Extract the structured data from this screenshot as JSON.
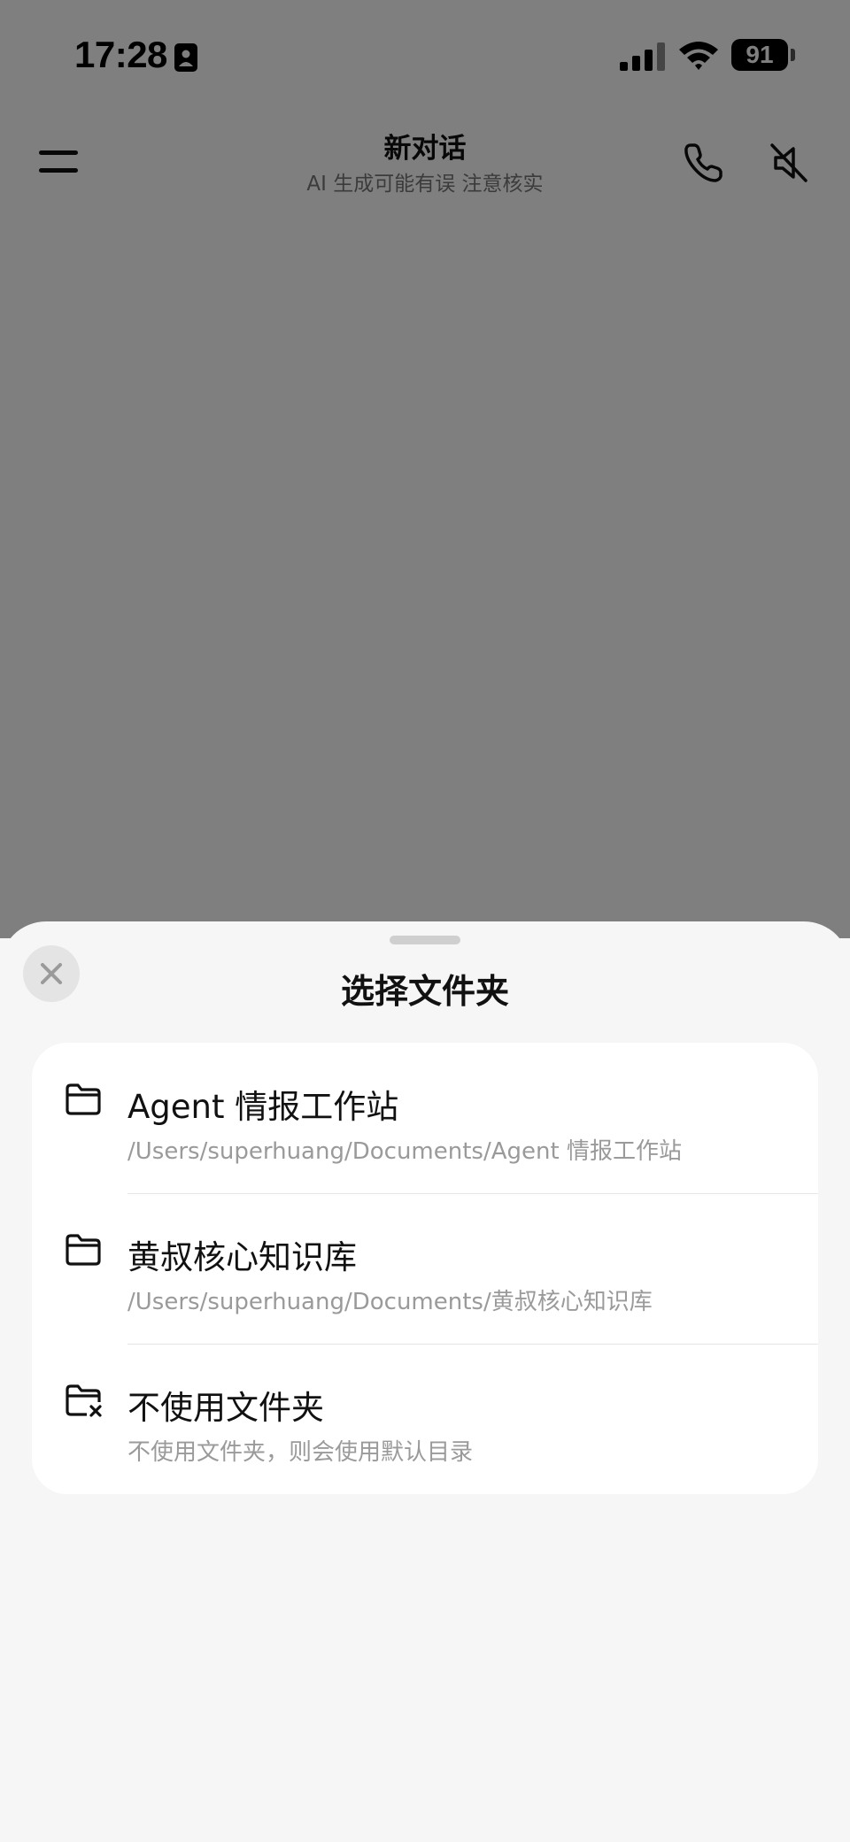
{
  "status_bar": {
    "time": "17:28",
    "battery_level": "91",
    "id_icon": "person-card-icon",
    "signal_icon": "cellular-signal-icon",
    "wifi_icon": "wifi-icon",
    "battery_icon": "battery-icon"
  },
  "header": {
    "title": "新对话",
    "subtitle": "AI 生成可能有误 注意核实",
    "menu_icon": "menu-icon",
    "call_icon": "phone-icon",
    "mute_icon": "speaker-muted-icon"
  },
  "sheet": {
    "title": "选择文件夹",
    "close_icon": "close-icon",
    "options": [
      {
        "title": "Agent 情报工作站",
        "subtitle": "/Users/superhuang/Documents/Agent 情报工作站",
        "icon": "folder-icon"
      },
      {
        "title": "黄叔核心知识库",
        "subtitle": "/Users/superhuang/Documents/黄叔核心知识库",
        "icon": "folder-icon"
      },
      {
        "title": "不使用文件夹",
        "subtitle": "不使用文件夹，则会使用默认目录",
        "icon": "folder-off-icon"
      }
    ]
  },
  "colors": {
    "overlay": "#7f7f7f",
    "sheet_background": "#f6f6f6",
    "card_background": "#ffffff",
    "primary_text": "#111111",
    "secondary_text": "#9a9a9a"
  }
}
